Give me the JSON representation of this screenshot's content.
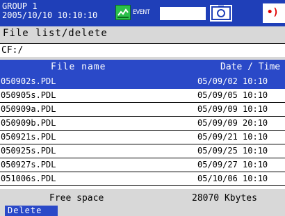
{
  "status": {
    "group": "GROUP 1",
    "datetime": "2005/10/10 10:10:10",
    "event_label": "EVENT",
    "alarm_symbol": "•)"
  },
  "panel": {
    "title": "File list/delete",
    "path": "CF:/"
  },
  "table": {
    "col_name": "File name",
    "col_date": "Date / Time",
    "rows": [
      {
        "name": "050902s.PDL",
        "date": "05/09/02 10:10",
        "selected": true
      },
      {
        "name": "050905s.PDL",
        "date": "05/09/05 10:10"
      },
      {
        "name": "050909a.PDL",
        "date": "05/09/09 10:10"
      },
      {
        "name": "050909b.PDL",
        "date": "05/09/09 20:10"
      },
      {
        "name": "050921s.PDL",
        "date": "05/09/21 10:10"
      },
      {
        "name": "050925s.PDL",
        "date": "05/09/25 10:10"
      },
      {
        "name": "050927s.PDL",
        "date": "05/09/27 10:10"
      },
      {
        "name": "051006s.PDL",
        "date": "05/10/06 10:10"
      }
    ]
  },
  "footer": {
    "free_label": "Free space",
    "free_value": "28070 Kbytes",
    "delete_label": "Delete"
  },
  "colors": {
    "status_bar": "#1f3fb8",
    "selection": "#2a49c8",
    "event_icon": "#2bbf4a",
    "alarm": "#e00000"
  },
  "icons": [
    "event-icon",
    "camera-icon",
    "alarm-icon"
  ]
}
